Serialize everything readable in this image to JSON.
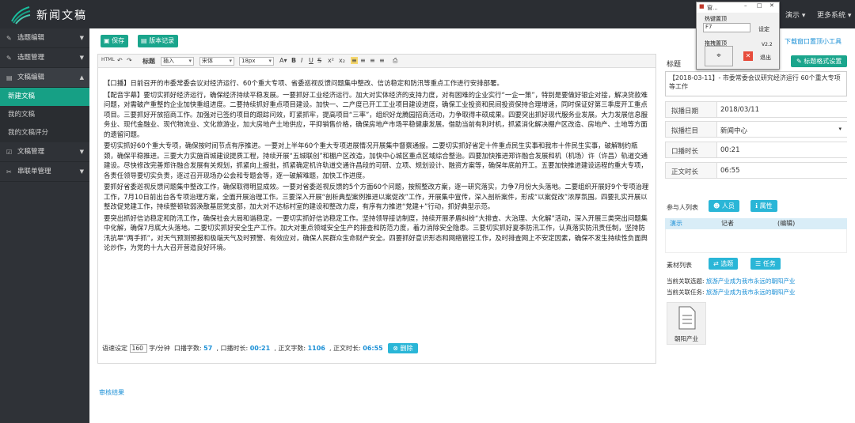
{
  "app": {
    "name": "新闻文稿"
  },
  "topnav": {
    "user": "演示",
    "more": "更多系统"
  },
  "sidebar": {
    "groups": [
      {
        "label": "选题编辑"
      },
      {
        "label": "选题管理"
      },
      {
        "label": "文稿编辑"
      }
    ],
    "subitems": [
      {
        "label": "新建文稿"
      },
      {
        "label": "我的文稿"
      },
      {
        "label": "我的文稿评分"
      }
    ],
    "after": [
      {
        "label": "文稿管理"
      },
      {
        "label": "串联单管理"
      }
    ]
  },
  "toolbar": {
    "save_label": "保存",
    "version_label": "版本记录",
    "download_link": "下载窗口置顶小工具",
    "title_style_label": "标题格式设置",
    "heading_label": "标题",
    "insert_select": "插入",
    "font_select": "宋体",
    "size_select": "18px"
  },
  "content": {
    "paragraphs": [
      "【口播】日前召开的市委常委会议对经济运行、60个重大专项、省委巡视反馈问题集中整改、信访稳定和防汛等重点工作进行安排部署。",
      "【配音字幕】要切实抓好经济运行，确保经济持续平稳发展。一要抓好工业经济运行。加大对实体经济的支持力度，对有困难的企业实行“一企一策”，特别是要做好银企对接，解决贷款难问题，对需破产重整的企业加快重组进度。二要持续抓好重点项目建设。加快一、二产度已开工工业项目建设进度，确保工业投资和民间投资保持合理增速，同时保证好第三季度开工重点项目。三要抓好开放招商工作。加强对已签约项目的跟踪问效，盯紧抓牢，提高项目“三率”，组织好龙腾园招商活动，力争取得丰硕成果。四要突出抓好现代服务业发展。大力发展信息服务业、现代金融业、现代物流业、文化旅游业，加大房地产土地供应，平抑销售价格，确保房地产市场平稳健康发展。借助当前有利时机，抓紧消化解决棚户区改造、房地产、土地等方面的遗留问题。",
      "要切实抓好60个重大专项，确保按时间节点有序推进。一要对上半年60个重大专项进展情况开展集中督察通报。二要切实抓好省定十件重点民生实事和我市十件民生实事，破解制约瓶颈，确保平稳推进。三要大力实施百城建设提质工程，持续开展“五城联创”和棚户区改造，加快中心城区重点区域综合整治。四要加快推进郑许融合发展和机（机场）许（许昌）轨道交通建设。尽快修改完善郑许融合发展有关规划，抓紧向上报批，抓紧确定机许轨道交通许昌段的可研、立项、规划设计、融资方案等，确保年底前开工。五要加快推进建设远程的重大专项，各责任领导要切实负责，逐过召开现场办公会和专题会等，逐一破解难题，加快工作进度。",
      "要抓好省委巡视反馈问题集中整改工作，确保取得明显成效。一要对省委巡视反馈的5个方面60个问题，按照整改方案，逐一研究落实，力争7月份大头落地。二要组织开展好9个专项治理工作，7月10日前出台各专项治理方案，全面开展治理工作。三要深入开展“剖析典型案例推进以案促改”工作，开展集中宣传，深入剖析案件，形成“以案促改”浓厚氛围。四要扎实开展以整改促党建工作，持续整顿软弱涣散基层党支部，加大对不达标村室的建设和整改力度，有序有力推进“党建+”行动，抓好典型示范。",
      "要突出抓好信访稳定和防汛工作，确保社会大局和谐稳定。一要切实抓好信访稳定工作。坚持领导接访制度，持续开展矛盾纠纷“大排查、大治理、大化解”活动，深入开展三类突出问题集中化解，确保7月底大头落地。二要切实抓好安全生产工作。加大对重点领域安全生产的排查和防范力度，着力消除安全隐患。三要切实抓好夏季防汛工作，认真落实防汛责任制，坚持防汛抗旱“两手抓”，对天气预测预报和极端天气及时预警、有效应对，确保人民群众生命财产安全。四要抓好意识形态和网络管控工作，及时排查网上不安定因素，确保不发生持续性负面舆论炒作，为党的十九大召开营造良好环境。"
    ]
  },
  "status": {
    "speed_label": "语速设定",
    "speed_value": "160",
    "speed_unit": "字/分钟",
    "voice_count_label": "口播字数",
    "voice_count": "57",
    "voice_time_label": "口播时长",
    "voice_time": "00:21",
    "text_count_label": "正文字数",
    "text_count": "1106",
    "text_time_label": "正文时长",
    "text_time": "06:55",
    "delete_label": "删除",
    "review_label": "审核结果"
  },
  "form": {
    "title_label": "标题",
    "title_value": "【2018-03-11】- 市委常委会议研究经济运行 60个重大专项等工作",
    "date_label": "拟播日期",
    "date_value": "2018/03/11",
    "column_label": "拟播栏目",
    "column_value": "新闻中心",
    "voice_time_label": "口播时长",
    "voice_time_value": "00:21",
    "text_time_label": "正文时长",
    "text_time_value": "06:55",
    "participants_label": "参与人列表",
    "person_btn": "人员",
    "attr_btn": "属性",
    "table_head": [
      "演示",
      "记者",
      "(编辑)"
    ],
    "materials_label": "素材列表",
    "topic_btn": "选题",
    "task_btn": "任务",
    "current_topic_label": "当前关联选题:",
    "current_topic_value": "旅游产业成为我市永远的朝阳产业",
    "current_task_label": "当前关联任务:",
    "current_task_value": "旅游产业成为我市永远的朝阳产业",
    "file_name": "朝阳产业"
  },
  "popup": {
    "title": "窗...",
    "hotkey_label": "热键置顶",
    "hotkey_value": "F7",
    "set_btn": "设定",
    "drag_label": "拖拽置顶",
    "version": "V2.2",
    "exit_label": "退出"
  },
  "colors": {
    "teal": "#1aa58c",
    "cyan": "#2ab6d7",
    "sidebar": "#2f3237",
    "link": "#1a8fd6"
  }
}
